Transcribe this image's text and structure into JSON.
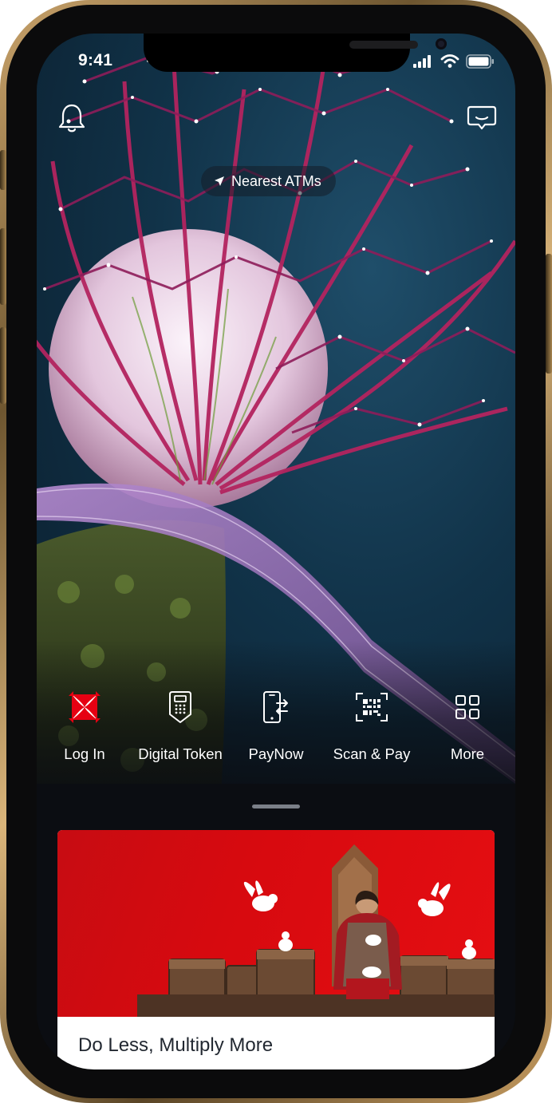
{
  "status_bar": {
    "time": "9:41"
  },
  "header": {
    "left_icon": "bell-icon",
    "right_icon": "chat-icon"
  },
  "nearest_atms": {
    "icon": "location-arrow-icon",
    "label": "Nearest ATMs"
  },
  "quick_actions": [
    {
      "label": "Log In",
      "icon": "dbs-logo-icon"
    },
    {
      "label": "Digital Token",
      "icon": "token-device-icon"
    },
    {
      "label": "PayNow",
      "icon": "phone-transfer-icon"
    },
    {
      "label": "Scan & Pay",
      "icon": "qr-scan-icon"
    },
    {
      "label": "More",
      "icon": "grid-icon"
    }
  ],
  "promo": {
    "title": "Do Less, Multiply More"
  },
  "colors": {
    "brand_red": "#e60012",
    "text_dark": "#222831",
    "sheet_background": "#0b0d12"
  }
}
